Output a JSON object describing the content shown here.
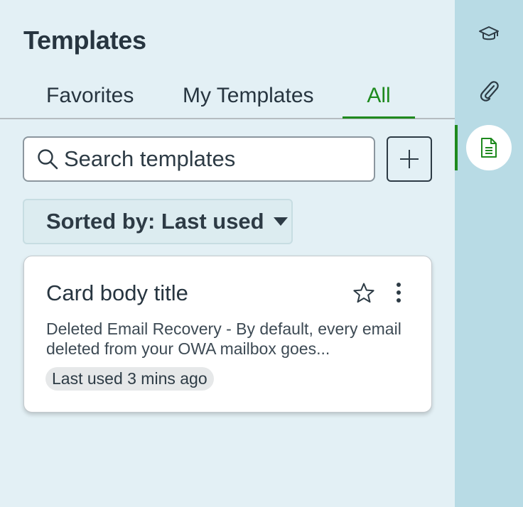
{
  "panel": {
    "title": "Templates",
    "tabs": [
      {
        "label": "Favorites",
        "active": false
      },
      {
        "label": "My Templates",
        "active": false
      },
      {
        "label": "All",
        "active": true
      }
    ],
    "search": {
      "placeholder": "Search templates",
      "value": ""
    },
    "add_button": {
      "icon": "plus-icon"
    },
    "sort": {
      "label": "Sorted by: Last used",
      "icon": "caret-down-icon"
    },
    "card": {
      "title": "Card body title",
      "description": "Deleted Email Recovery - By default, every email deleted from your OWA mailbox goes...",
      "last_used": "Last used 3 mins ago",
      "favorite_icon": "star-icon",
      "menu_icon": "more-vertical-icon"
    }
  },
  "rail": {
    "items": [
      {
        "icon": "graduation-cap-icon",
        "active": false
      },
      {
        "icon": "paperclip-icon",
        "active": false
      },
      {
        "icon": "document-icon",
        "active": true
      }
    ]
  },
  "colors": {
    "accent": "#1e8a1e",
    "panel_bg": "#e3f0f5",
    "rail_bg": "#b8dbe5",
    "text": "#273540"
  }
}
